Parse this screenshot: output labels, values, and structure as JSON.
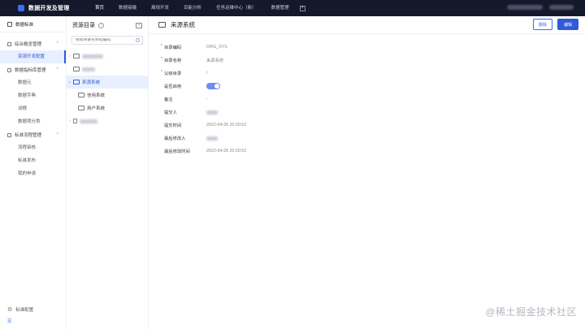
{
  "app": {
    "title": "数据开发及管理"
  },
  "nav": {
    "items": [
      "首页",
      "数据接输",
      "离线开发",
      "目能分析",
      "任务运维中心（新）",
      "数据管理"
    ],
    "active_index": 0
  },
  "sidebar": {
    "header": "数据标准",
    "groups": [
      {
        "label": "综合概览管理",
        "items": [
          "资源开发配置"
        ]
      },
      {
        "label": "数据指标库管理",
        "items": [
          "数据元",
          "数据字典",
          "词根",
          "数据项分类"
        ]
      },
      {
        "label": "标准流程管理",
        "items": [
          "流程审核",
          "标准发布",
          "我的申请"
        ]
      }
    ],
    "footer": "标准配置"
  },
  "tree": {
    "title": "资源目录",
    "search_placeholder": "搜索目录名称或编码",
    "selected": "来源系统",
    "children": [
      "信用系统",
      "用户系统"
    ]
  },
  "detail": {
    "title": "来源系统",
    "delete_label": "删除",
    "edit_label": "编辑",
    "fields": [
      {
        "label": "目录编码",
        "value": "ORG_SYS",
        "required": true
      },
      {
        "label": "目录名称",
        "value": "来源系统",
        "required": true
      },
      {
        "label": "父级目录",
        "value": "/",
        "required": true
      },
      {
        "label": "是否启用",
        "value": "",
        "required": false
      },
      {
        "label": "备注",
        "value": "-",
        "required": false
      },
      {
        "label": "提交人",
        "value": "",
        "required": false
      },
      {
        "label": "提交时间",
        "value": "2022-04-26 20:20:52",
        "required": false
      },
      {
        "label": "最后修改人",
        "value": "",
        "required": false
      },
      {
        "label": "最后修改时间",
        "value": "2022-04-26 20:20:52",
        "required": false
      }
    ]
  },
  "watermark": "@稀土掘金技术社区",
  "colors": {
    "accent": "#2f5bd8",
    "topbar": "#14182b"
  }
}
